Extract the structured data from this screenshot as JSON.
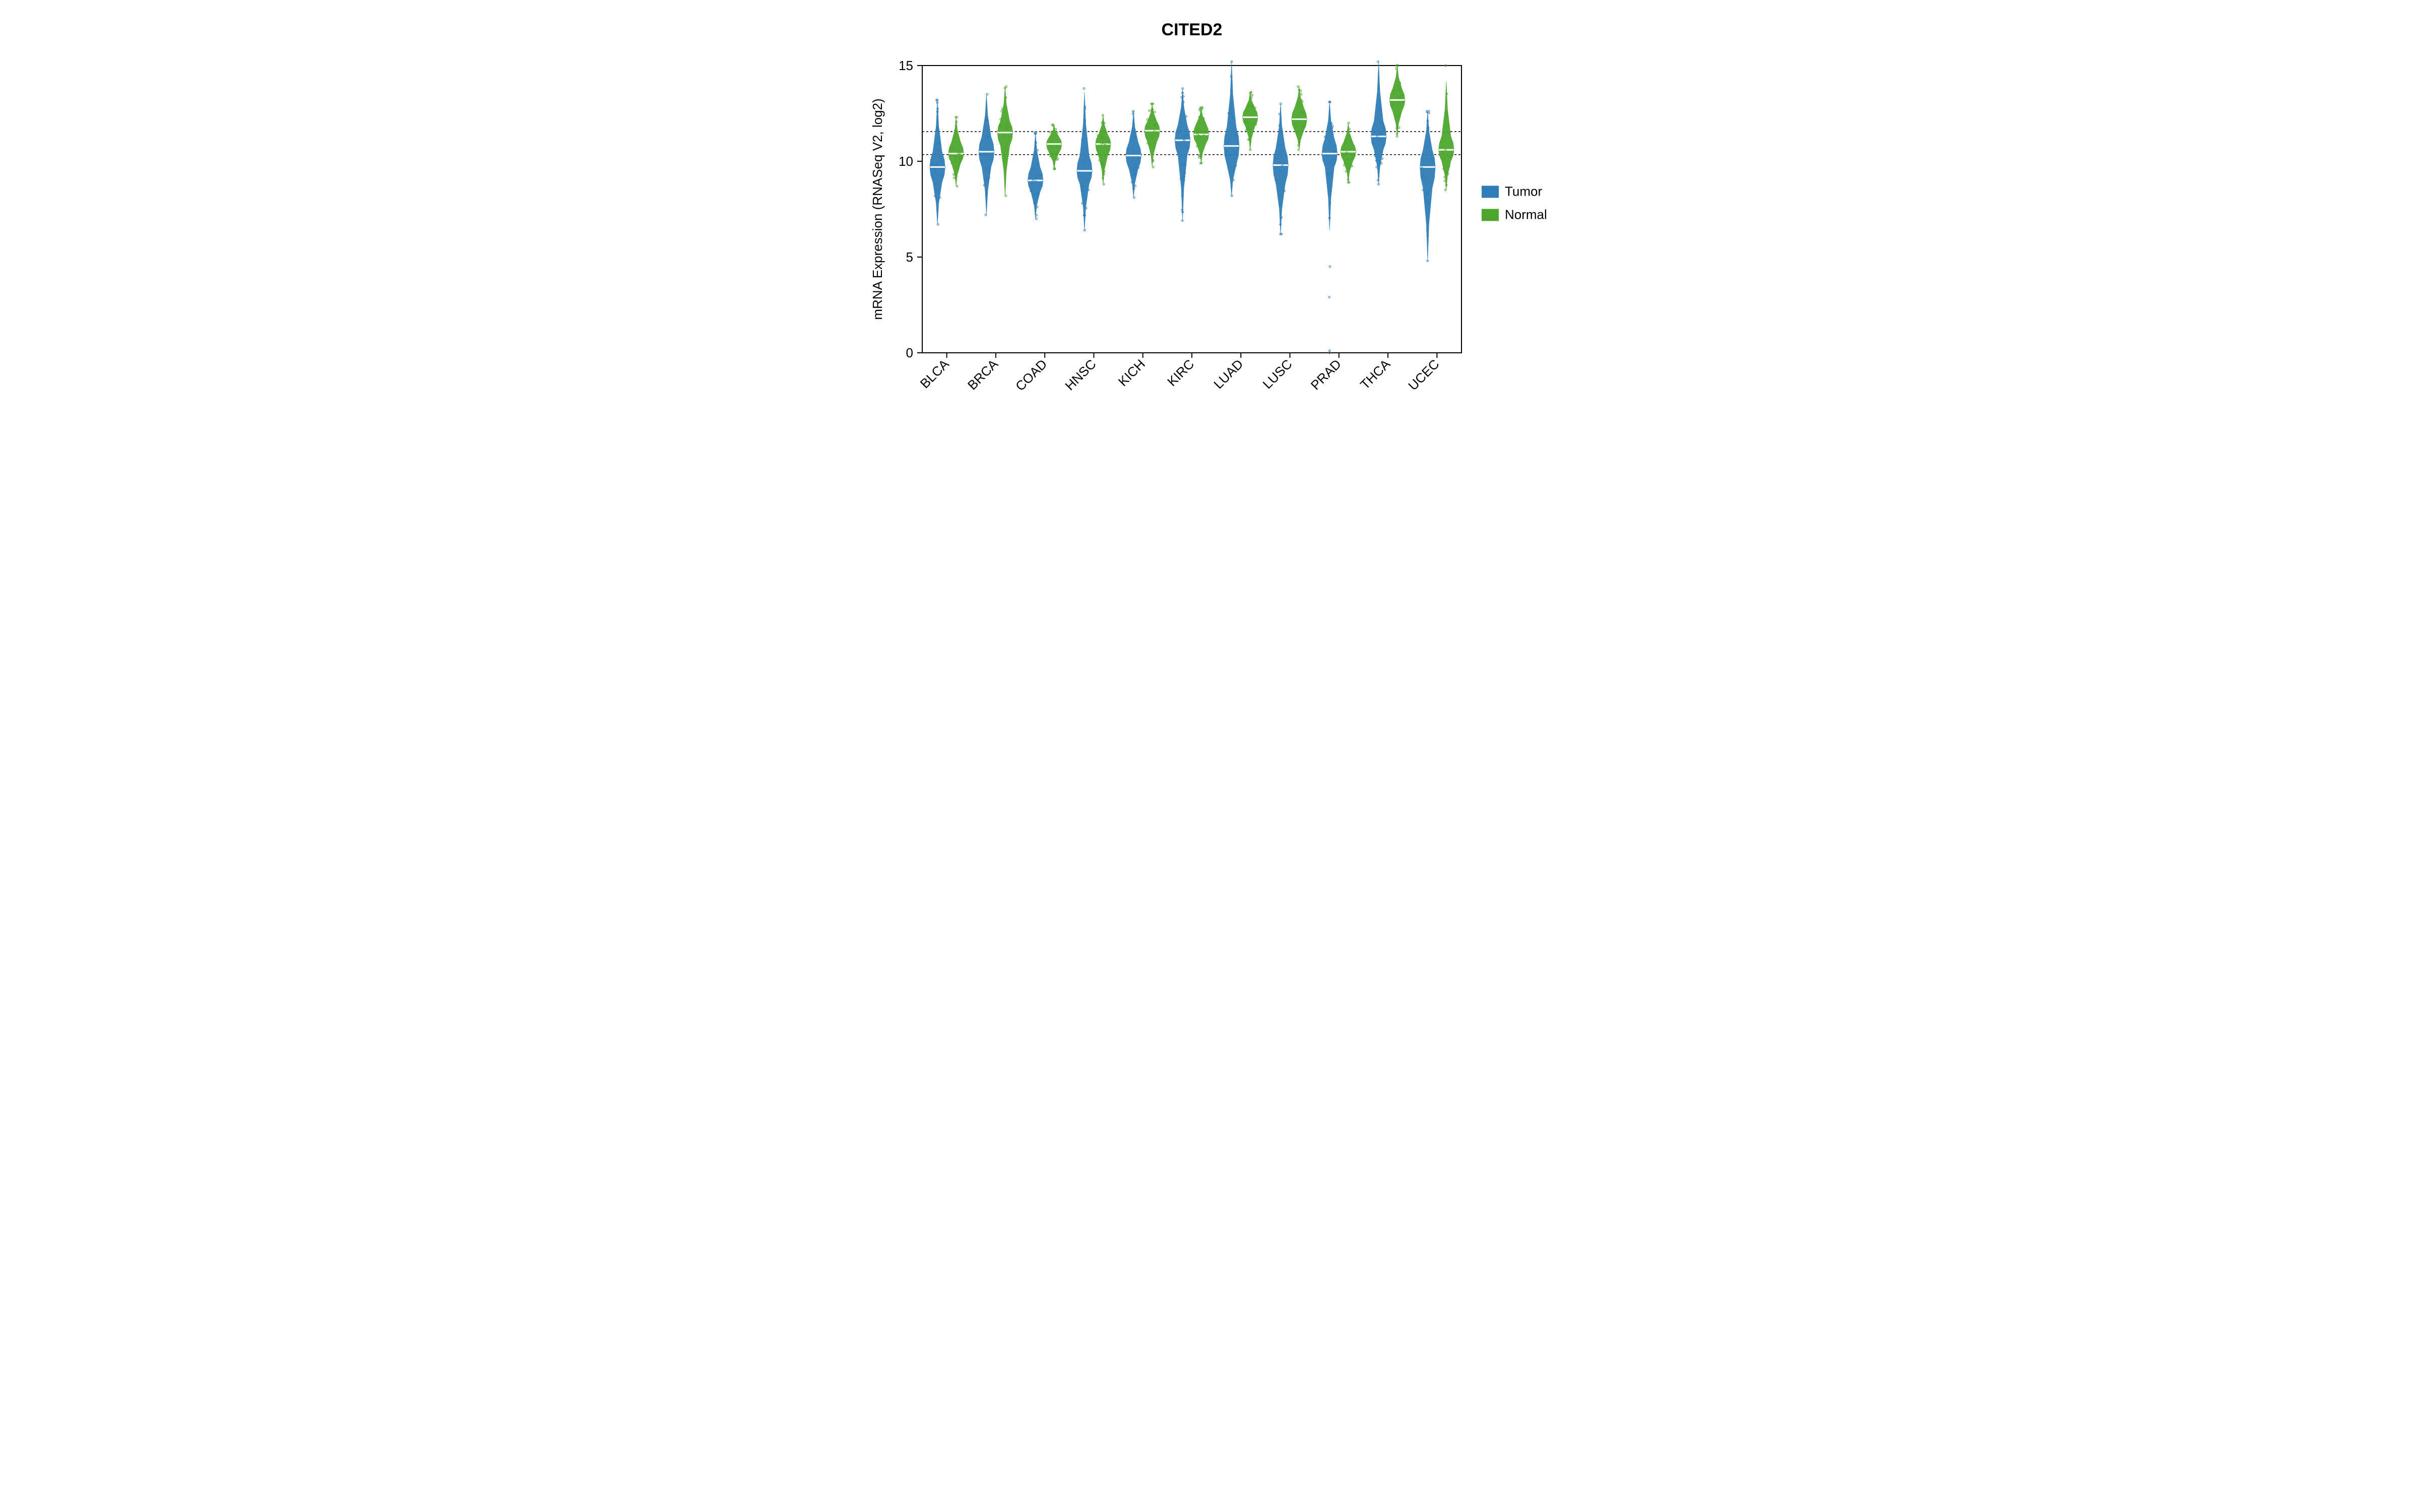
{
  "chart_data": {
    "type": "violin",
    "title": "CITED2",
    "ylabel": "mRNA Expression (RNASeq V2, log2)",
    "xlabel": "",
    "ylim": [
      0,
      15
    ],
    "yticks": [
      0,
      5,
      10,
      15
    ],
    "categories": [
      "BLCA",
      "BRCA",
      "COAD",
      "HNSC",
      "KICH",
      "KIRC",
      "LUAD",
      "LUSC",
      "PRAD",
      "THCA",
      "UCEC"
    ],
    "series": [
      {
        "name": "Tumor",
        "color": "#2f7db8",
        "medians": [
          9.7,
          10.5,
          9.0,
          9.5,
          10.3,
          11.1,
          10.8,
          9.8,
          10.4,
          11.3,
          9.7
        ],
        "q1": [
          8.9,
          9.7,
          8.4,
          8.8,
          9.6,
          10.3,
          9.8,
          8.8,
          9.7,
          10.6,
          8.6
        ],
        "q3": [
          10.5,
          11.3,
          9.7,
          10.3,
          11.0,
          11.9,
          11.8,
          10.7,
          11.2,
          12.1,
          10.6
        ],
        "min": [
          6.7,
          7.2,
          7.0,
          6.4,
          8.1,
          6.9,
          8.2,
          6.2,
          0.0,
          8.8,
          4.8
        ],
        "max": [
          13.2,
          13.5,
          11.5,
          13.8,
          12.6,
          13.8,
          15.2,
          13.0,
          13.1,
          15.2,
          12.6
        ]
      },
      {
        "name": "Normal",
        "color": "#4ea62e",
        "medians": [
          10.4,
          11.5,
          10.9,
          10.9,
          11.6,
          11.4,
          12.3,
          12.2,
          10.5,
          13.2,
          10.6
        ],
        "q1": [
          9.9,
          10.8,
          10.4,
          10.3,
          11.0,
          10.9,
          11.8,
          11.6,
          10.0,
          12.6,
          10.0
        ],
        "q3": [
          11.0,
          12.1,
          11.3,
          11.4,
          12.1,
          12.0,
          12.8,
          12.8,
          11.0,
          13.8,
          11.3
        ],
        "min": [
          8.7,
          8.2,
          9.6,
          8.8,
          9.7,
          9.9,
          10.6,
          10.6,
          8.9,
          11.3,
          8.5
        ],
        "max": [
          12.3,
          13.9,
          11.9,
          12.4,
          13.0,
          12.8,
          13.6,
          13.9,
          12.0,
          15.0,
          15.0
        ]
      }
    ],
    "hlines": [
      10.35,
      11.55
    ],
    "legend": {
      "position": "right",
      "items": [
        {
          "label": "Tumor",
          "color": "#2f7db8"
        },
        {
          "label": "Normal",
          "color": "#4ea62e"
        }
      ]
    }
  }
}
